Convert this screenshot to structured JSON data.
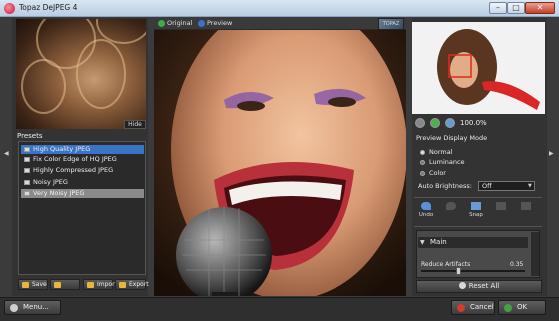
{
  "window": {
    "title": "Topaz DeJPEG 4"
  },
  "left": {
    "hide_label": "Hide",
    "presets_label": "Presets",
    "presets": [
      "High Quality JPEG",
      "Fix Color Edge of HQ JPEG",
      "Highly Compressed JPEG",
      "Noisy JPEG",
      "Very Noisy JPEG"
    ],
    "buttons": {
      "save": "Save",
      "import": "Import",
      "export": "Export"
    }
  },
  "center": {
    "tab_original": "Original",
    "tab_preview": "Preview"
  },
  "right": {
    "zoom_level": "100.0%",
    "preview_display_mode": "Preview Display Mode",
    "modes": [
      "Normal",
      "Luminance",
      "Color"
    ],
    "auto_brightness_label": "Auto Brightness:",
    "auto_brightness_value": "Off",
    "tools": {
      "undo": "Undo",
      "snap": "Snap"
    },
    "section_main": "Main",
    "reduce_artifacts_label": "Reduce Artifacts",
    "reduce_artifacts_value": "0.35",
    "reset_label": "Reset All"
  },
  "bottom": {
    "menu": "Menu...",
    "cancel": "Cancel",
    "ok": "OK"
  },
  "colors": {
    "selection_blue": "#3a74c9",
    "panel_bg": "#333333",
    "accent_red": "#e32a1e"
  }
}
